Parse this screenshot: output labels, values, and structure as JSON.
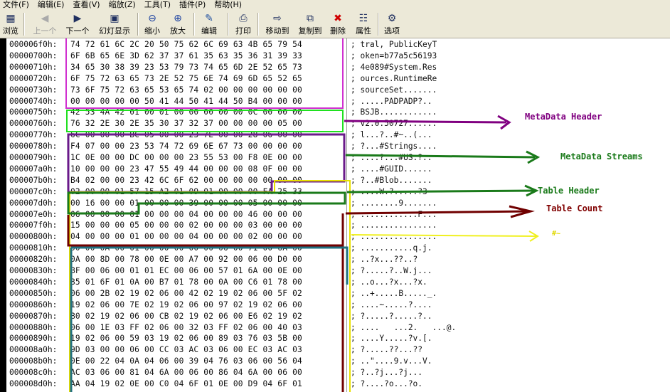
{
  "menu": [
    "文件(F)",
    "编辑(E)",
    "查看(V)",
    "缩放(Z)",
    "工具(T)",
    "插件(P)",
    "帮助(H)"
  ],
  "toolbar": [
    {
      "label": "浏览",
      "icon": "browse-icon",
      "disabled": false
    },
    {
      "label": "上一个",
      "icon": "prev-icon",
      "disabled": true
    },
    {
      "label": "下一个",
      "icon": "next-icon",
      "disabled": false
    },
    {
      "label": "幻灯显示",
      "icon": "slideshow-icon",
      "disabled": false
    },
    {
      "label": "缩小",
      "icon": "zoom-out-icon",
      "disabled": false
    },
    {
      "label": "放大",
      "icon": "zoom-in-icon",
      "disabled": false
    },
    {
      "label": "编辑",
      "icon": "edit-icon",
      "disabled": false
    },
    {
      "label": "打印",
      "icon": "print-icon",
      "disabled": false
    },
    {
      "label": "移动到",
      "icon": "move-to-icon",
      "disabled": false
    },
    {
      "label": "复制到",
      "icon": "copy-to-icon",
      "disabled": false
    },
    {
      "label": "删除",
      "icon": "delete-icon",
      "disabled": false
    },
    {
      "label": "属性",
      "icon": "properties-icon",
      "disabled": false
    },
    {
      "label": "选项",
      "icon": "options-icon",
      "disabled": false
    }
  ],
  "rows": [
    {
      "addr": "000006f0h:",
      "bytes": "74 72 61 6C 2C 20 50 75 62 6C 69 63 4B 65 79 54",
      "ascii": "; tral, PublicKeyT"
    },
    {
      "addr": "00000700h:",
      "bytes": "6F 6B 65 6E 3D 62 37 37 61 35 63 35 36 31 39 33",
      "ascii": "; oken=b77a5c56193"
    },
    {
      "addr": "00000710h:",
      "bytes": "34 65 30 38 39 23 53 79 73 74 65 6D 2E 52 65 73",
      "ascii": "; 4e089#System.Res"
    },
    {
      "addr": "00000720h:",
      "bytes": "6F 75 72 63 65 73 2E 52 75 6E 74 69 6D 65 52 65",
      "ascii": "; ources.RuntimeRe"
    },
    {
      "addr": "00000730h:",
      "bytes": "73 6F 75 72 63 65 53 65 74 02 00 00 00 00 00 00",
      "ascii": "; sourceSet......."
    },
    {
      "addr": "00000740h:",
      "bytes": "00 00 00 00 00 50 41 44 50 41 44 50 B4 00 00 00",
      "ascii": "; .....PADPADP?.."
    },
    {
      "addr": "00000750h:",
      "bytes": "42 53 4A 42 01 00 01 00 00 00 00 00 0C 00 00 00",
      "ascii": "; BSJB............"
    },
    {
      "addr": "00000760h:",
      "bytes": "76 32 2E 30 2E 35 30 37 32 37 00 00 00 00 05 00",
      "ascii": "; v2.0.50727......"
    },
    {
      "addr": "00000770h:",
      "bytes": "6C 00 00 00 BC 05 00 00 23 7E 00 00 28 06 00 00",
      "ascii": "; l...?..#~..(..."
    },
    {
      "addr": "00000780h:",
      "bytes": "F4 07 00 00 23 53 74 72 69 6E 67 73 00 00 00 00",
      "ascii": "; ?...#Strings...."
    },
    {
      "addr": "00000790h:",
      "bytes": "1C 0E 00 00 DC 00 00 00 23 55 53 00 F8 0E 00 00",
      "ascii": "; ....?...#US.?.."
    },
    {
      "addr": "000007a0h:",
      "bytes": "10 00 00 00 23 47 55 49 44 00 00 00 08 0F 00 00",
      "ascii": "; ....#GUID......"
    },
    {
      "addr": "000007b0h:",
      "bytes": "B4 02 00 00 23 42 6C 6F 62 00 00 00 00 00 00 00",
      "ascii": "; ?..#Blob......."
    },
    {
      "addr": "000007c0h:",
      "bytes": "02 00 00 01 57 15 A2 01 09 01 00 00 00 FA 25 33",
      "ascii": "; ....W.?.....?3"
    },
    {
      "addr": "000007d0h:",
      "bytes": "00 16 00 00 01 00 00 00 39 00 00 00 05 00 00 00",
      "ascii": "; ........9......."
    },
    {
      "addr": "000007e0h:",
      "bytes": "06 00 00 00 01 00 00 00 04 00 00 00 46 00 00 00",
      "ascii": "; ............F..."
    },
    {
      "addr": "000007f0h:",
      "bytes": "15 00 00 00 05 00 00 00 02 00 00 00 03 00 00 00",
      "ascii": "; ................"
    },
    {
      "addr": "00000800h:",
      "bytes": "04 00 00 00 01 00 00 00 04 00 00 00 02 00 00 00",
      "ascii": "; ................"
    },
    {
      "addr": "00000810h:",
      "bytes": "00 00 0A 00 01 00 00 00 00 00 06 00 71 00 6A 00",
      "ascii": "; ...........q.j."
    },
    {
      "addr": "00000820h:",
      "bytes": "0A 00 8D 00 78 00 0E 00 A7 00 92 00 06 00 D0 00",
      "ascii": "; ..?x...??..?"
    },
    {
      "addr": "00000830h:",
      "bytes": "BF 00 06 00 01 01 EC 00 06 00 57 01 6A 00 0E 00",
      "ascii": "; ?.....?..W.j..."
    },
    {
      "addr": "00000840h:",
      "bytes": "85 01 6F 01 0A 00 B7 01 78 00 0A 00 C6 01 78 00",
      "ascii": "; ..o...?x...?x."
    },
    {
      "addr": "00000850h:",
      "bytes": "06 00 2B 02 19 02 06 00 42 02 19 02 06 00 5F 02",
      "ascii": "; ..+.....B....._."
    },
    {
      "addr": "00000860h:",
      "bytes": "19 02 06 00 7E 02 19 02 06 00 97 02 19 02 06 00",
      "ascii": "; ....~.....?...."
    },
    {
      "addr": "00000870h:",
      "bytes": "B0 02 19 02 06 00 CB 02 19 02 06 00 E6 02 19 02",
      "ascii": "; ?.....?.....?.."
    },
    {
      "addr": "00000880h:",
      "bytes": "06 00 1E 03 FF 02 06 00 32 03 FF 02 06 00 40 03",
      "ascii": "; ....   ...2.   ...@."
    },
    {
      "addr": "00000890h:",
      "bytes": "19 02 06 00 59 03 19 02 06 00 89 03 76 03 5B 00",
      "ascii": "; ....Y.....?v.[."
    },
    {
      "addr": "000008a0h:",
      "bytes": "9D 03 00 00 06 00 CC 03 AC 03 06 00 EC 03 AC 03",
      "ascii": "; ?.....??...??"
    },
    {
      "addr": "000008b0h:",
      "bytes": "0E 00 22 04 0A 04 06 00 39 04 76 03 06 00 56 04",
      "ascii": "; ..\"....9.v...V."
    },
    {
      "addr": "000008c0h:",
      "bytes": "AC 03 06 00 81 04 6A 00 06 00 86 04 6A 00 06 00",
      "ascii": "; ?..?j...?j..."
    },
    {
      "addr": "000008d0h:",
      "bytes": "AA 04 19 02 0E 00 C0 04 6F 01 0E 00 D9 04 6F 01",
      "ascii": "; ?....?o...?o."
    }
  ],
  "annotations": [
    {
      "text": "MetaData Header",
      "color": "#800080"
    },
    {
      "text": "MetaData Streams",
      "color": "#1a7a1a"
    },
    {
      "text": "Table Header",
      "color": "#1a7a1a"
    },
    {
      "text": "Table Count",
      "color": "#800000"
    },
    {
      "text": "#~",
      "color": "#e0d800"
    }
  ]
}
